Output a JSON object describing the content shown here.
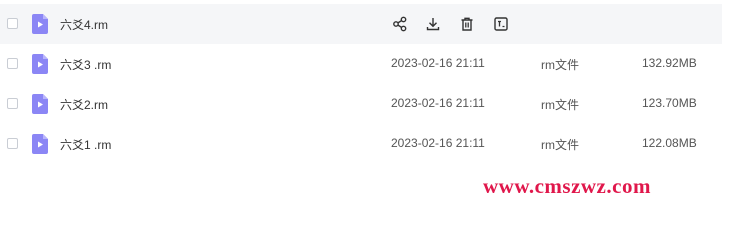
{
  "files": [
    {
      "name": "六爻4.rm",
      "date": "",
      "type": "",
      "size": "",
      "hovered": true
    },
    {
      "name": "六爻3 .rm",
      "date": "2023-02-16 21:11",
      "type": "rm文件",
      "size": "132.92MB"
    },
    {
      "name": "六爻2.rm",
      "date": "2023-02-16 21:11",
      "type": "rm文件",
      "size": "123.70MB"
    },
    {
      "name": "六爻1 .rm",
      "date": "2023-02-16 21:11",
      "type": "rm文件",
      "size": "122.08MB"
    }
  ],
  "row_actions": [
    {
      "icon": "share-icon"
    },
    {
      "icon": "download-icon"
    },
    {
      "icon": "trash-icon"
    },
    {
      "icon": "rename-icon"
    }
  ],
  "watermark": "www.cmszwz.com",
  "colors": {
    "file_icon": "#8b86f5",
    "hover_row": "#f5f6f8",
    "watermark": "#e0174b"
  }
}
